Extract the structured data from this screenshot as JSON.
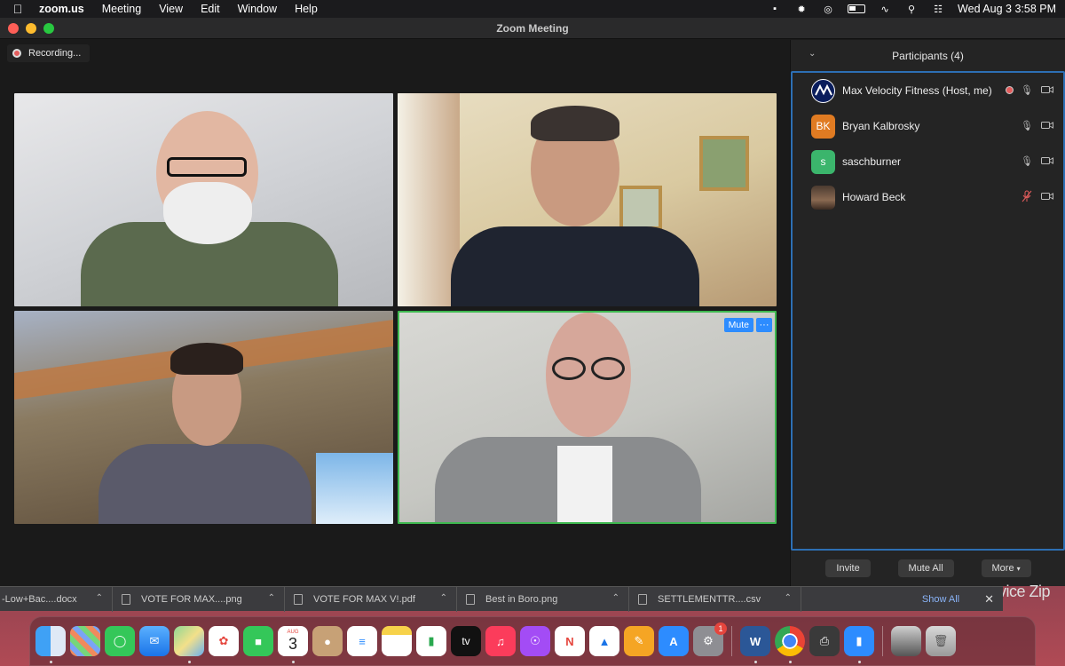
{
  "menubar": {
    "app": "zoom.us",
    "items": [
      "Meeting",
      "View",
      "Edit",
      "Window",
      "Help"
    ],
    "clock": "Wed Aug 3  3:58 PM"
  },
  "window": {
    "title": "Zoom Meeting"
  },
  "recording": {
    "label": "Recording..."
  },
  "tile_controls": {
    "mute": "Mute",
    "more": "···"
  },
  "participants": {
    "header": "Participants (4)",
    "items": [
      {
        "name": "Max Velocity Fitness (Host, me)",
        "avatar": "logo",
        "recording": true,
        "mic": "on",
        "cam": "off"
      },
      {
        "name": "Bryan Kalbrosky",
        "initials": "BK",
        "avatar_color": "#e07b22",
        "mic": "on",
        "cam": "off"
      },
      {
        "name": "saschburner",
        "initials": "s",
        "avatar_color": "#3bb56c",
        "mic": "on",
        "cam": "off"
      },
      {
        "name": "Howard Beck",
        "avatar": "photo",
        "mic": "muted",
        "cam": "off"
      }
    ],
    "buttons": {
      "invite": "Invite",
      "mute_all": "Mute All",
      "more": "More"
    }
  },
  "downloads": {
    "items": [
      "-Low+Bac....docx",
      "VOTE FOR MAX....png",
      "VOTE FOR MAX V!.pdf",
      "Best in Boro.png",
      "SETTLEMENTTR....csv"
    ],
    "show_all": "Show All"
  },
  "background_text": "vice Zip",
  "dock": {
    "icons": [
      "finder-icon",
      "launchpad-icon",
      "messages-icon",
      "mail-icon",
      "maps-icon",
      "photos-icon",
      "facetime-icon",
      "calendar-icon",
      "contacts-icon",
      "reminders-icon",
      "notes-icon",
      "numbers-icon",
      "appletv-icon",
      "music-icon",
      "podcasts-icon",
      "news-icon",
      "keynote-icon",
      "pages-icon",
      "appstore-icon",
      "systemprefs-icon",
      "word-icon",
      "chrome-icon",
      "printer-icon",
      "zoom-icon",
      "photo-thumb-icon",
      "trash-icon"
    ],
    "calendar": {
      "month": "AUG",
      "day": "3"
    },
    "tv_label": "tv",
    "systemprefs_badge": "1"
  }
}
